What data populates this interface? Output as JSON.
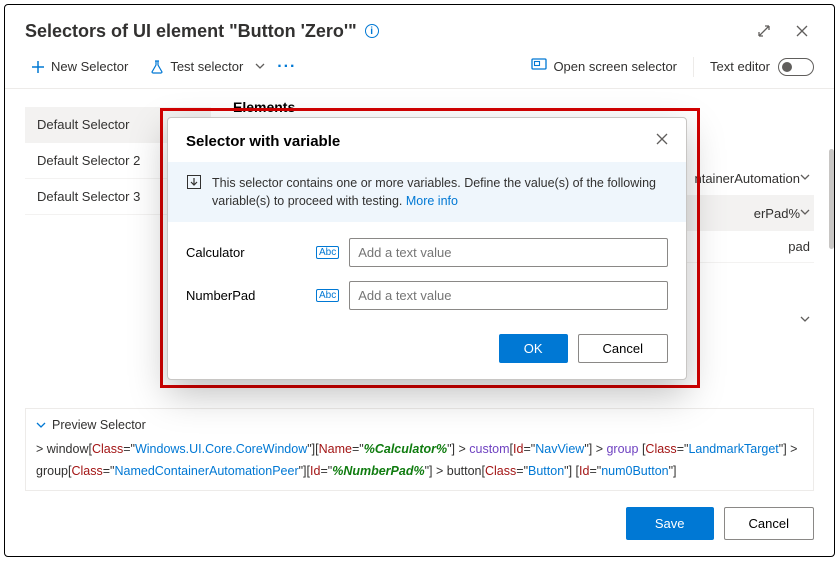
{
  "title": "Selectors of UI element \"Button 'Zero'\"",
  "toolbar": {
    "new_selector": "New Selector",
    "test_selector": "Test selector",
    "open_screen": "Open screen selector",
    "text_editor": "Text editor"
  },
  "sidebar": {
    "items": [
      {
        "label": "Default Selector",
        "active": true
      },
      {
        "label": "Default Selector 2"
      },
      {
        "label": "Default Selector 3"
      }
    ]
  },
  "elements": {
    "heading": "Elements",
    "rows": [
      {
        "text": "ntainerAutomation"
      },
      {
        "text": "erPad%",
        "selected": true
      },
      {
        "text": "pad"
      }
    ]
  },
  "dialog": {
    "title": "Selector with variable",
    "info_text": "This selector contains one or more variables. Define the value(s) of the following variable(s) to proceed with testing. ",
    "more_info": "More info",
    "fields": [
      {
        "name": "Calculator",
        "placeholder": "Add a text value"
      },
      {
        "name": "NumberPad",
        "placeholder": "Add a text value"
      }
    ],
    "ok": "OK",
    "cancel": "Cancel"
  },
  "preview": {
    "heading": "Preview Selector",
    "tokens": [
      {
        "c": "t-op",
        "t": "> "
      },
      {
        "c": "t-kw",
        "t": "window"
      },
      {
        "c": "t-op",
        "t": "["
      },
      {
        "c": "t-attr",
        "t": "Class"
      },
      {
        "c": "t-op",
        "t": "=\""
      },
      {
        "c": "t-val",
        "t": "Windows.UI.Core.CoreWindow"
      },
      {
        "c": "t-op",
        "t": "\"]["
      },
      {
        "c": "t-attr",
        "t": "Name"
      },
      {
        "c": "t-op",
        "t": "=\""
      },
      {
        "c": "t-var",
        "t": "%Calculator%"
      },
      {
        "c": "t-op",
        "t": "\"] > "
      },
      {
        "c": "t-elem",
        "t": "custom"
      },
      {
        "c": "t-op",
        "t": "["
      },
      {
        "c": "t-attr",
        "t": "Id"
      },
      {
        "c": "t-op",
        "t": "=\""
      },
      {
        "c": "t-val",
        "t": "NavView"
      },
      {
        "c": "t-op",
        "t": "\"] > "
      },
      {
        "c": "t-elem",
        "t": "group"
      },
      {
        "c": "t-op",
        "t": " ["
      },
      {
        "c": "t-attr",
        "t": "Class"
      },
      {
        "c": "t-op",
        "t": "=\""
      },
      {
        "c": "t-val",
        "t": "LandmarkTarget"
      },
      {
        "c": "t-op",
        "t": "\"] > "
      },
      {
        "c": "t-kw",
        "t": "group"
      },
      {
        "c": "t-op",
        "t": "["
      },
      {
        "c": "t-attr",
        "t": "Class"
      },
      {
        "c": "t-op",
        "t": "=\""
      },
      {
        "c": "t-val",
        "t": "NamedContainerAutomationPeer"
      },
      {
        "c": "t-op",
        "t": "\"]["
      },
      {
        "c": "t-attr",
        "t": "Id"
      },
      {
        "c": "t-op",
        "t": "=\""
      },
      {
        "c": "t-var",
        "t": "%NumberPad%"
      },
      {
        "c": "t-op",
        "t": "\"] > "
      },
      {
        "c": "t-kw",
        "t": "button"
      },
      {
        "c": "t-op",
        "t": "["
      },
      {
        "c": "t-attr",
        "t": "Class"
      },
      {
        "c": "t-op",
        "t": "=\""
      },
      {
        "c": "t-val",
        "t": "Button"
      },
      {
        "c": "t-op",
        "t": "\"] ["
      },
      {
        "c": "t-attr",
        "t": "Id"
      },
      {
        "c": "t-op",
        "t": "=\""
      },
      {
        "c": "t-val",
        "t": "num0Button"
      },
      {
        "c": "t-op",
        "t": "\"]"
      }
    ]
  },
  "footer": {
    "save": "Save",
    "cancel": "Cancel"
  }
}
